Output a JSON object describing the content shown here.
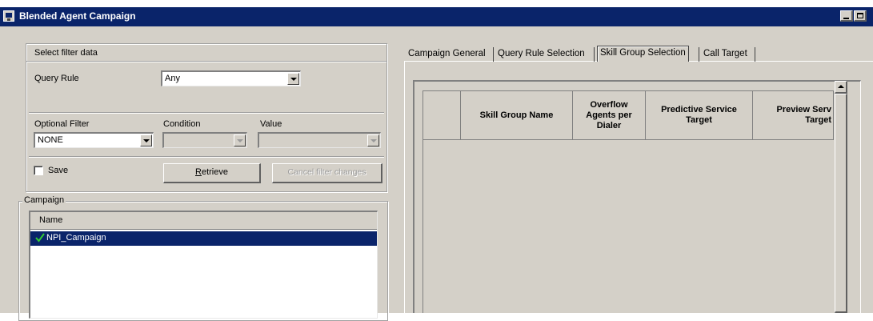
{
  "window": {
    "title": "Blended Agent Campaign"
  },
  "filter": {
    "group_label": "Select filter data",
    "query_rule_label": "Query Rule",
    "query_rule_value": "Any",
    "optional_filter_label": "Optional Filter",
    "optional_filter_value": "NONE",
    "condition_label": "Condition",
    "condition_value": "",
    "value_label": "Value",
    "value_value": "",
    "save_label": "Save",
    "save_checked": false,
    "retrieve_label": "Retrieve",
    "retrieve_mnemonic": "R",
    "retrieve_rest": "etrieve",
    "cancel_label": "Cancel filter changes"
  },
  "campaign": {
    "group_label": "Campaign",
    "column_name": "Name",
    "items": [
      {
        "name": "NPI_Campaign",
        "selected": true,
        "checked": true
      }
    ]
  },
  "tabs": [
    {
      "label": "Campaign General",
      "active": false
    },
    {
      "label": "Query Rule Selection",
      "active": false
    },
    {
      "label": "Skill Group Selection",
      "active": true
    },
    {
      "label": "Call Target",
      "active": false
    }
  ],
  "skill_grid": {
    "columns": [
      "",
      "Skill Group Name",
      "Overflow Agents per Dialer",
      "Predictive Service Target",
      "Preview Service Target"
    ],
    "columns_display": [
      "",
      "Skill Group Name",
      "Overflow\nAgents per\nDialer",
      "Predictive Service\nTarget",
      "Preview Serv\nTarget"
    ],
    "rows": []
  },
  "colors": {
    "titlebar": "#0a246a",
    "selection": "#0a246a",
    "face": "#d4d0c8"
  }
}
